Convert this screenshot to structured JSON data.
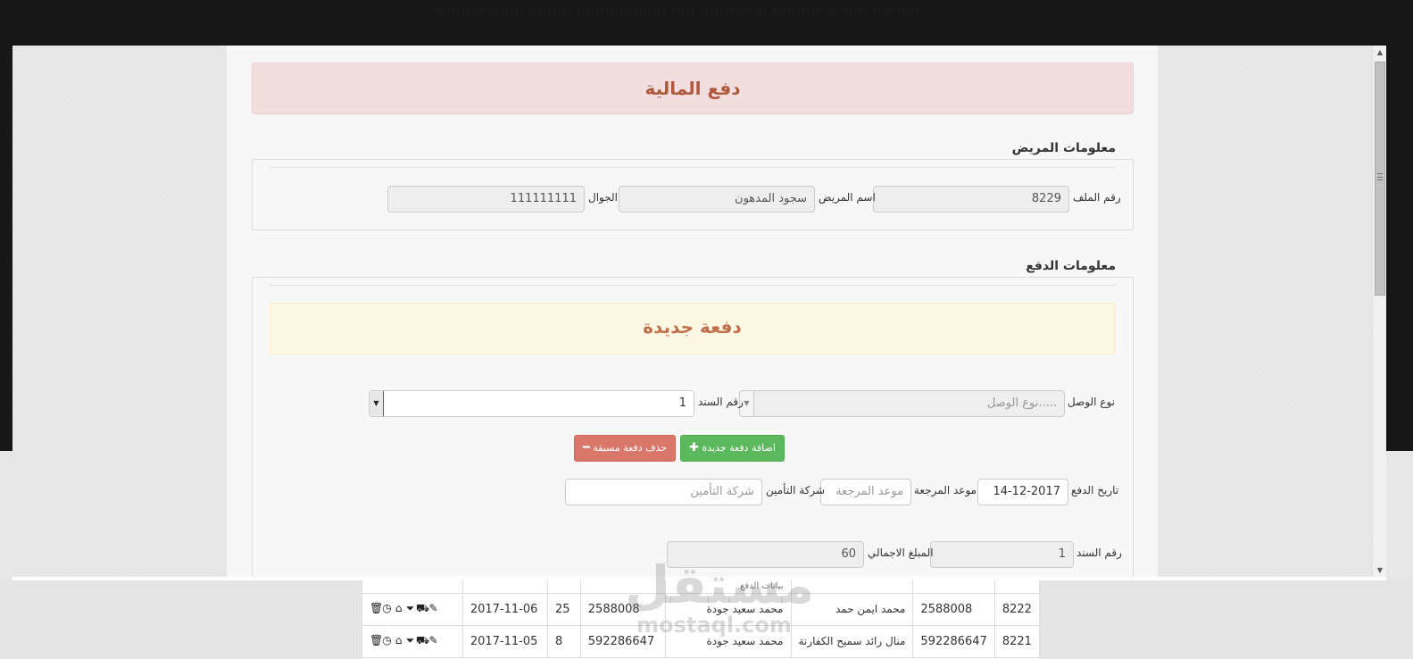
{
  "header": {
    "title": "دفع المالية"
  },
  "patient_info": {
    "legend": "معلومات المريض",
    "file_number_label": "رقم الملف",
    "file_number_value": "8229",
    "name_label": "اسم المريض",
    "name_value": "سجود   المدهون",
    "mobile_label": "الجوال",
    "mobile_value": "111111111"
  },
  "payment_info": {
    "legend": "معلومات الدفع",
    "new_payment_title": "دفعة جديدة",
    "receipt_type_label": "نوع الوصل",
    "receipt_type_placeholder": "نوع الوصل.....",
    "bond_number_label": "رقم السند",
    "bond_number_value": "1",
    "add_button_label": "اضافة دفعة جديدة",
    "delete_button_label": "حذف دفعة مسبقة",
    "payment_date_label": "تاريخ الدفع",
    "payment_date_value": "14-12-2017",
    "review_label": "موعد المرجعة",
    "review_placeholder": "موعد المرجعة",
    "insurance_label": "شركة التأمين",
    "insurance_placeholder": "شركة التأمين",
    "bond_number2_label": "رقم السند",
    "bond_number2_value": "1",
    "total_label": "المبلغ الاجمالي",
    "total_value": "60"
  },
  "table": {
    "partial_header": "بيانات الدفع",
    "rows": [
      {
        "id": "8222",
        "mobile": "2588008",
        "patient": "محمد ايمن حمد",
        "doctor": "محمد سعيد جودة",
        "phone": "2588008",
        "amount": "25",
        "date": "2017-11-06"
      },
      {
        "id": "8221",
        "mobile": "592286647",
        "patient": "منال رائد سميح الكفارنة",
        "doctor": "محمد سعيد جودة",
        "phone": "592286647",
        "amount": "8",
        "date": "2017-11-05"
      }
    ]
  },
  "watermark": {
    "arabic": "مستقل",
    "latin": "mostaql.com"
  },
  "icons": {
    "add": "plus-icon",
    "delete": "minus-icon",
    "row_actions": [
      "trash-icon",
      "clock-icon",
      "home-icon",
      "filter-icon",
      "cart-icon",
      "edit-icon"
    ]
  },
  "colors": {
    "danger_bg": "#f2dede",
    "danger_text": "#b0583c",
    "warning_bg": "#fcf8e3",
    "success": "#5cb85c",
    "danger_button": "#d9776a"
  }
}
